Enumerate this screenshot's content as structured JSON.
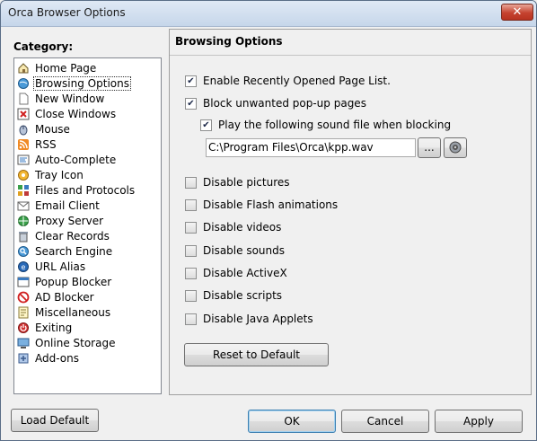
{
  "window": {
    "title": "Orca Browser Options"
  },
  "sidebar": {
    "label": "Category:",
    "items": [
      {
        "label": "Home Page",
        "icon": "home-icon"
      },
      {
        "label": "Browsing Options",
        "icon": "browse-icon",
        "selected": true
      },
      {
        "label": "New Window",
        "icon": "new-window-icon"
      },
      {
        "label": "Close Windows",
        "icon": "close-windows-icon"
      },
      {
        "label": "Mouse",
        "icon": "mouse-icon"
      },
      {
        "label": "RSS",
        "icon": "rss-icon"
      },
      {
        "label": "Auto-Complete",
        "icon": "autocomplete-icon"
      },
      {
        "label": "Tray Icon",
        "icon": "tray-icon"
      },
      {
        "label": "Files and Protocols",
        "icon": "files-icon"
      },
      {
        "label": "Email Client",
        "icon": "email-icon"
      },
      {
        "label": "Proxy Server",
        "icon": "proxy-icon"
      },
      {
        "label": "Clear Records",
        "icon": "trash-icon"
      },
      {
        "label": "Search Engine",
        "icon": "search-engine-icon"
      },
      {
        "label": "URL Alias",
        "icon": "url-alias-icon"
      },
      {
        "label": "Popup Blocker",
        "icon": "popup-blocker-icon"
      },
      {
        "label": "AD Blocker",
        "icon": "ad-blocker-icon"
      },
      {
        "label": "Miscellaneous",
        "icon": "misc-icon"
      },
      {
        "label": "Exiting",
        "icon": "power-icon"
      },
      {
        "label": "Online Storage",
        "icon": "storage-icon"
      },
      {
        "label": "Add-ons",
        "icon": "addons-icon"
      }
    ]
  },
  "panel": {
    "title": "Browsing Options",
    "enable_recent": {
      "label": "Enable Recently Opened Page List.",
      "checked": true
    },
    "block_popups": {
      "label": "Block unwanted pop-up pages",
      "checked": true
    },
    "play_sound": {
      "label": "Play the following sound file when blocking",
      "checked": true
    },
    "sound_path": "C:\\Program Files\\Orca\\kpp.wav",
    "browse_label": "...",
    "disable": [
      {
        "label": "Disable pictures",
        "checked": false
      },
      {
        "label": "Disable Flash animations",
        "checked": false
      },
      {
        "label": "Disable videos",
        "checked": false
      },
      {
        "label": "Disable sounds",
        "checked": false
      },
      {
        "label": "Disable ActiveX",
        "checked": false
      },
      {
        "label": "Disable scripts",
        "checked": false
      },
      {
        "label": "Disable Java Applets",
        "checked": false
      }
    ],
    "reset_label": "Reset to Default"
  },
  "footer": {
    "load_default": "Load Default",
    "ok": "OK",
    "cancel": "Cancel",
    "apply": "Apply"
  }
}
